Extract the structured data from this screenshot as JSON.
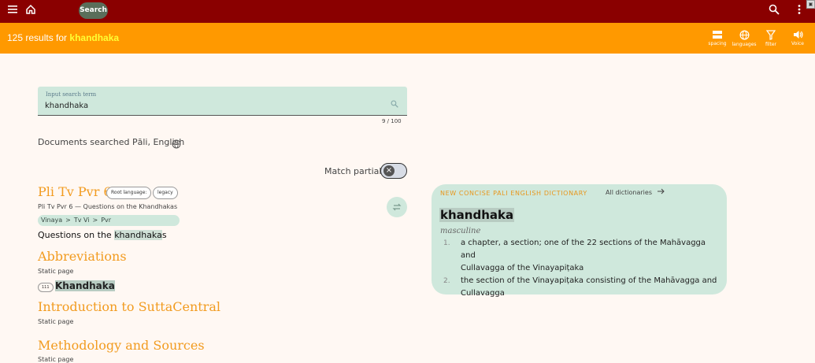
{
  "topbar": {
    "search_label": "Search"
  },
  "results_bar": {
    "prefix": "125 results for",
    "term": "khandhaka",
    "tools": [
      {
        "label": "spacing",
        "icon": "spacing-icon"
      },
      {
        "label": "languages",
        "icon": "globe-icon"
      },
      {
        "label": "filter",
        "icon": "filter-icon"
      },
      {
        "label": "Voice",
        "icon": "speaker-icon"
      }
    ]
  },
  "search": {
    "label": "Input search term",
    "value": "khandhaka",
    "counter": "9 / 100"
  },
  "docs_searched": "Documents searched Pāli, English",
  "match_partial_label": "Match partial",
  "results": [
    {
      "title": "Pli Tv Pvr 6",
      "chip_root": "Root language:",
      "chip_legacy": "legacy",
      "subtitle": "Pli Tv Pvr 6 — Questions on the Khandhakas",
      "breadcrumb": [
        "Vinaya",
        ">",
        "Tv Vi",
        ">",
        "Pvr"
      ],
      "snippet_pre": "Questions on the ",
      "snippet_hl": "khandhaka",
      "snippet_post": "s"
    },
    {
      "title": "Abbreviations",
      "subtitle": "Static page",
      "count": "111",
      "link": "Khandhaka"
    },
    {
      "title": "Introduction to SuttaCentral",
      "subtitle": "Static page"
    },
    {
      "title": "Methodology and Sources",
      "subtitle": "Static page"
    }
  ],
  "dictionary": {
    "name": "NEW CONCISE PALI ENGLISH DICTIONARY",
    "all_link": "All dictionaries",
    "headword": "khandhaka",
    "grammar": "masculine",
    "definitions": [
      {
        "num": "1.",
        "line1": "a chapter, a section; one of the 22 sections of the Mahāvagga and",
        "line2": "Cullavagga of the Vinayapiṭaka"
      },
      {
        "num": "2.",
        "line1": "the section of the Vinayapiṭaka consisting of the Mahāvagga and",
        "line2": "Cullavagga"
      }
    ]
  }
}
